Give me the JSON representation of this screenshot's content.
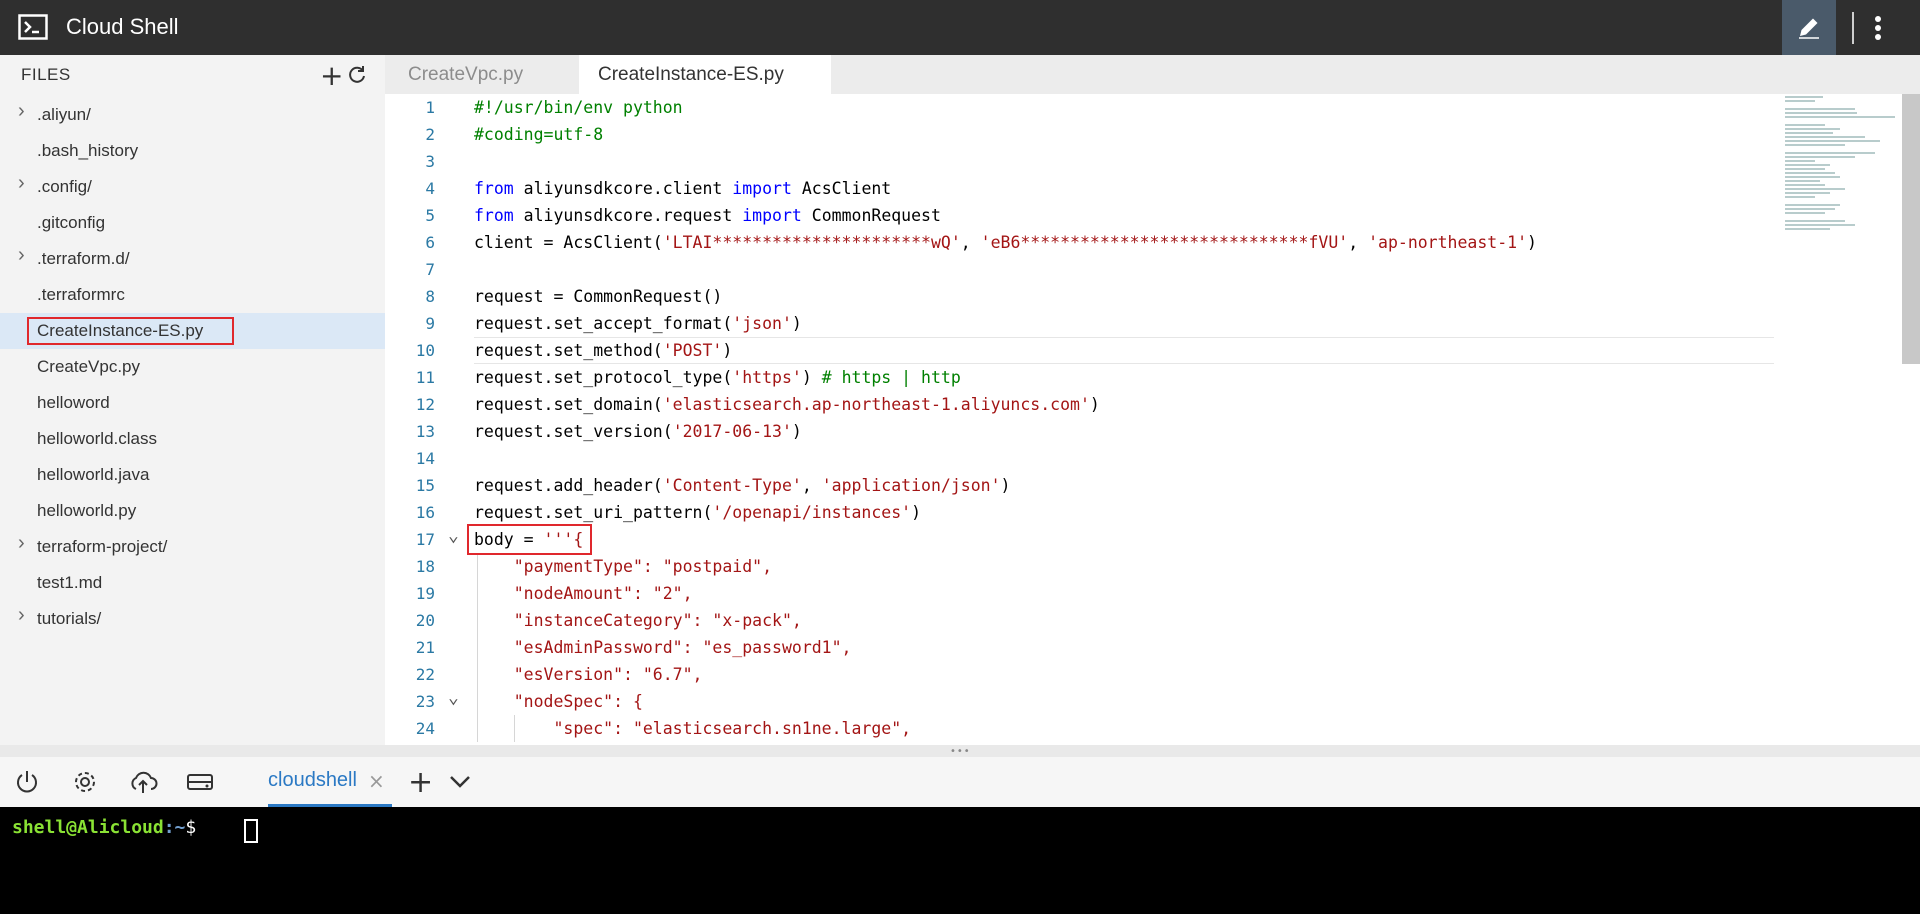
{
  "app": {
    "title": "Cloud Shell"
  },
  "sidebar": {
    "header": "FILES",
    "items": [
      {
        "label": ".aliyun/",
        "folder": true
      },
      {
        "label": ".bash_history",
        "folder": false
      },
      {
        "label": ".config/",
        "folder": true
      },
      {
        "label": ".gitconfig",
        "folder": false
      },
      {
        "label": ".terraform.d/",
        "folder": true
      },
      {
        "label": ".terraformrc",
        "folder": false
      },
      {
        "label": "CreateInstance-ES.py",
        "folder": false,
        "selected": true
      },
      {
        "label": "CreateVpc.py",
        "folder": false
      },
      {
        "label": "helloword",
        "folder": false
      },
      {
        "label": "helloworld.class",
        "folder": false
      },
      {
        "label": "helloworld.java",
        "folder": false
      },
      {
        "label": "helloworld.py",
        "folder": false
      },
      {
        "label": "terraform-project/",
        "folder": true
      },
      {
        "label": "test1.md",
        "folder": false
      },
      {
        "label": "tutorials/",
        "folder": true
      }
    ]
  },
  "editor": {
    "tabs": [
      {
        "label": "CreateVpc.py",
        "active": false
      },
      {
        "label": "CreateInstance-ES.py",
        "active": true
      }
    ],
    "lines": [
      {
        "n": "1",
        "tokens": [
          [
            "cm",
            "#!/usr/bin/env python"
          ]
        ]
      },
      {
        "n": "2",
        "tokens": [
          [
            "cm",
            "#coding=utf-8"
          ]
        ]
      },
      {
        "n": "3",
        "tokens": []
      },
      {
        "n": "4",
        "tokens": [
          [
            "kw",
            "from"
          ],
          [
            "",
            " aliyunsdkcore.client "
          ],
          [
            "kw",
            "import"
          ],
          [
            "",
            " AcsClient"
          ]
        ]
      },
      {
        "n": "5",
        "tokens": [
          [
            "kw",
            "from"
          ],
          [
            "",
            " aliyunsdkcore.request "
          ],
          [
            "kw",
            "import"
          ],
          [
            "",
            " CommonRequest"
          ]
        ]
      },
      {
        "n": "6",
        "tokens": [
          [
            "",
            "client = AcsClient("
          ],
          [
            "str",
            "'LTAI**********************wQ'"
          ],
          [
            "",
            ", "
          ],
          [
            "str",
            "'eB6*****************************fVU'"
          ],
          [
            "",
            ", "
          ],
          [
            "str",
            "'ap-northeast-1'"
          ],
          [
            "",
            ")"
          ]
        ]
      },
      {
        "n": "7",
        "tokens": []
      },
      {
        "n": "8",
        "tokens": [
          [
            "",
            "request = CommonRequest()"
          ]
        ]
      },
      {
        "n": "9",
        "tokens": [
          [
            "",
            "request.set_accept_format("
          ],
          [
            "str",
            "'json'"
          ],
          [
            "",
            ")"
          ]
        ]
      },
      {
        "n": "10",
        "tokens": [
          [
            "",
            "request.set_method("
          ],
          [
            "str",
            "'POST'"
          ],
          [
            "",
            ")"
          ]
        ]
      },
      {
        "n": "11",
        "tokens": [
          [
            "",
            "request.set_protocol_type("
          ],
          [
            "str",
            "'https'"
          ],
          [
            "",
            ") "
          ],
          [
            "cm",
            "# https | http"
          ]
        ]
      },
      {
        "n": "12",
        "tokens": [
          [
            "",
            "request.set_domain("
          ],
          [
            "str",
            "'elasticsearch.ap-northeast-1.aliyuncs.com'"
          ],
          [
            "",
            ")"
          ]
        ]
      },
      {
        "n": "13",
        "tokens": [
          [
            "",
            "request.set_version("
          ],
          [
            "str",
            "'2017-06-13'"
          ],
          [
            "",
            ")"
          ]
        ]
      },
      {
        "n": "14",
        "tokens": []
      },
      {
        "n": "15",
        "tokens": [
          [
            "",
            "request.add_header("
          ],
          [
            "str",
            "'Content-Type'"
          ],
          [
            "",
            ", "
          ],
          [
            "str",
            "'application/json'"
          ],
          [
            "",
            ")"
          ]
        ]
      },
      {
        "n": "16",
        "tokens": [
          [
            "",
            "request.set_uri_pattern("
          ],
          [
            "str",
            "'/openapi/instances'"
          ],
          [
            "",
            ")"
          ]
        ]
      },
      {
        "n": "17",
        "tokens": [
          [
            "",
            "body = "
          ],
          [
            "str",
            "'''{"
          ]
        ]
      },
      {
        "n": "18",
        "tokens": [
          [
            "str",
            "    \"paymentType\": \"postpaid\","
          ]
        ]
      },
      {
        "n": "19",
        "tokens": [
          [
            "str",
            "    \"nodeAmount\": \"2\","
          ]
        ]
      },
      {
        "n": "20",
        "tokens": [
          [
            "str",
            "    \"instanceCategory\": \"x-pack\","
          ]
        ]
      },
      {
        "n": "21",
        "tokens": [
          [
            "str",
            "    \"esAdminPassword\": \"es_password1\","
          ]
        ]
      },
      {
        "n": "22",
        "tokens": [
          [
            "str",
            "    \"esVersion\": \"6.7\","
          ]
        ]
      },
      {
        "n": "23",
        "tokens": [
          [
            "str",
            "    \"nodeSpec\": {"
          ]
        ]
      },
      {
        "n": "24",
        "tokens": [
          [
            "str",
            "        \"spec\": \"elasticsearch.sn1ne.large\","
          ]
        ]
      }
    ]
  },
  "terminal": {
    "tab_label": "cloudshell",
    "prompt_user": "shell@Alicloud",
    "prompt_path": ":~",
    "prompt_symbol": "$"
  },
  "colors": {
    "accent": "#2b79c4",
    "highlight_box": "#e0282d",
    "topbar": "#2f2f2f"
  }
}
